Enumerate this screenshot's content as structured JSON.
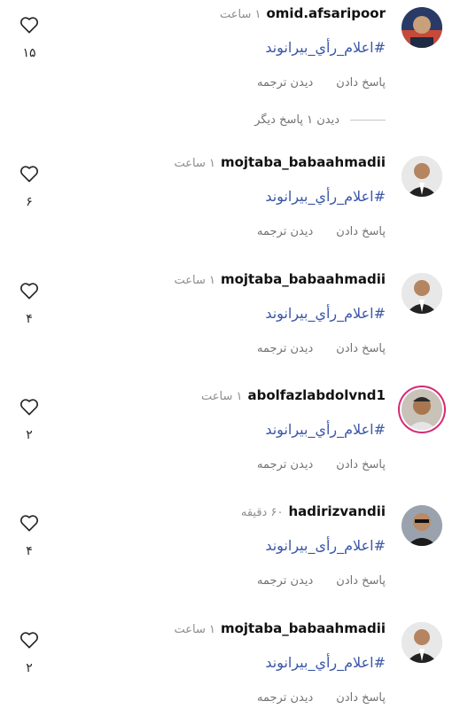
{
  "comments": [
    {
      "user": "omid.afsaripoor",
      "time": "۱ ساعت",
      "text": "#اعلام_رأي_بيرانوند",
      "reply": "پاسخ دادن",
      "translate": "دیدن ترجمه",
      "likes": "۱۵",
      "more": "دیدن ۱ پاسخ دیگر"
    },
    {
      "user": "mojtaba_babaahmadii",
      "time": "۱ ساعت",
      "text": "#اعلام_رأي_بيرانوند",
      "reply": "پاسخ دادن",
      "translate": "دیدن ترجمه",
      "likes": "۶"
    },
    {
      "user": "mojtaba_babaahmadii",
      "time": "۱ ساعت",
      "text": "#اعلام_رأي_بيرانوند",
      "reply": "پاسخ دادن",
      "translate": "دیدن ترجمه",
      "likes": "۴"
    },
    {
      "user": "abolfazlabdolvnd1",
      "time": "۱ ساعت",
      "text": "#اعلام_رأي_بيرانوند",
      "reply": "پاسخ دادن",
      "translate": "دیدن ترجمه",
      "likes": "۲"
    },
    {
      "user": "hadirizvandii",
      "time": "۶۰ دقیقه",
      "text": "#اعلام_رأی_بیرانوند",
      "reply": "پاسخ دادن",
      "translate": "دیدن ترجمه",
      "likes": "۴"
    },
    {
      "user": "mojtaba_babaahmadii",
      "time": "۱ ساعت",
      "text": "#اعلام_رأي_بيرانوند",
      "reply": "پاسخ دادن",
      "translate": "دیدن ترجمه",
      "likes": "۲"
    }
  ],
  "icons": {
    "like": "heart-outline-icon"
  },
  "colors": {
    "hashtag": "#3b57a7",
    "muted": "#8e8e8e",
    "story_ring": "#d62976"
  }
}
